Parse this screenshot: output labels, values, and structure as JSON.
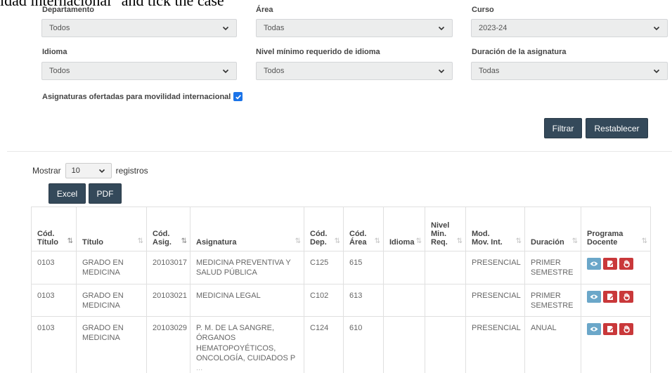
{
  "caption": "idad internacional\" and tick the case",
  "filters": {
    "row1": [
      {
        "label": "Departamento",
        "value": "Todos"
      },
      {
        "label": "Área",
        "value": "Todas"
      },
      {
        "label": "Curso",
        "value": "2023-24"
      }
    ],
    "row2": [
      {
        "label": "Idioma",
        "value": "Todos"
      },
      {
        "label": "Nivel mínimo requerido de idioma",
        "value": "Todos"
      },
      {
        "label": "Duración de la asignatura",
        "value": "Todas"
      }
    ],
    "mobility_label": "Asignaturas ofertadas para movilidad internacional",
    "mobility_checked": true,
    "filter_button": "Filtrar",
    "reset_button": "Restablecer"
  },
  "length": {
    "prefix": "Mostrar",
    "value": "10",
    "suffix": "registros"
  },
  "export": {
    "excel": "Excel",
    "pdf": "PDF"
  },
  "table": {
    "headers": [
      {
        "line1": "Cód.",
        "line2": "Título",
        "line3": ""
      },
      {
        "line1": "",
        "line2": "Título",
        "line3": ""
      },
      {
        "line1": "Cód.",
        "line2": "Asig.",
        "line3": ""
      },
      {
        "line1": "",
        "line2": "Asignatura",
        "line3": ""
      },
      {
        "line1": "Cód.",
        "line2": "Dep.",
        "line3": ""
      },
      {
        "line1": "Cód.",
        "line2": "Área",
        "line3": ""
      },
      {
        "line1": "",
        "line2": "Idioma",
        "line3": ""
      },
      {
        "line1": "Nivel",
        "line2": "Min.",
        "line3": "Req."
      },
      {
        "line1": "Mod.",
        "line2": "Mov. Int.",
        "line3": ""
      },
      {
        "line1": "",
        "line2": "Duración",
        "line3": ""
      },
      {
        "line1": "Programa",
        "line2": "Docente",
        "line3": ""
      }
    ],
    "rows": [
      {
        "cod_titulo": "0103",
        "titulo": "GRADO EN MEDICINA",
        "cod_asig": "20103017",
        "asignatura": "MEDICINA PREVENTIVA Y SALUD PÚBLICA",
        "asignatura_more": "",
        "cod_dep": "C125",
        "cod_area": "615",
        "idioma": "",
        "nivel": "",
        "mod": "PRESENCIAL",
        "duracion": "PRIMER SEMESTRE"
      },
      {
        "cod_titulo": "0103",
        "titulo": "GRADO EN MEDICINA",
        "cod_asig": "20103021",
        "asignatura": "MEDICINA LEGAL",
        "asignatura_more": "",
        "cod_dep": "C102",
        "cod_area": "613",
        "idioma": "",
        "nivel": "",
        "mod": "PRESENCIAL",
        "duracion": "PRIMER SEMESTRE"
      },
      {
        "cod_titulo": "0103",
        "titulo": "GRADO EN MEDICINA",
        "cod_asig": "20103029",
        "asignatura": "P. M. DE LA SANGRE, ÓRGANOS HEMATOPOYÉTICOS, ONCOLOGÍA, CUIDADOS P",
        "asignatura_more": "...",
        "cod_dep": "C124",
        "cod_area": "610",
        "idioma": "",
        "nivel": "",
        "mod": "PRESENCIAL",
        "duracion": "ANUAL"
      }
    ]
  },
  "icons": {
    "view": "eye-icon",
    "pdf": "document-edit-icon",
    "hand": "hand-icon"
  },
  "colors": {
    "dark_button": "#34495a",
    "view_button": "#6ba7c9",
    "red_button": "#c9383a",
    "checkbox": "#1a73e8"
  }
}
